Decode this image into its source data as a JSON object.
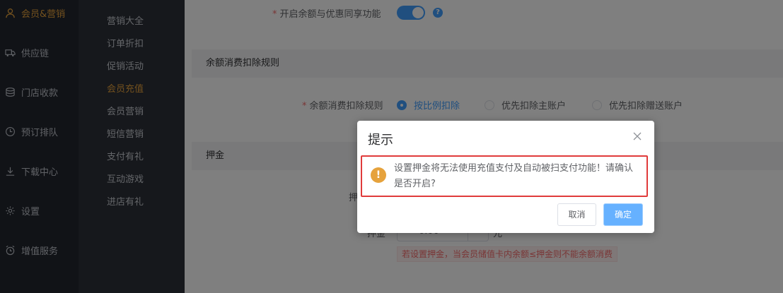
{
  "sidebar": {
    "items": [
      {
        "label": "会员&营销",
        "icon": "user-icon",
        "active": true
      },
      {
        "label": "供应链",
        "icon": "truck-icon",
        "active": false
      },
      {
        "label": "门店收款",
        "icon": "database-icon",
        "active": false
      },
      {
        "label": "预订排队",
        "icon": "clock-icon",
        "active": false
      },
      {
        "label": "下载中心",
        "icon": "download-icon",
        "active": false
      },
      {
        "label": "设置",
        "icon": "gear-icon",
        "active": false
      },
      {
        "label": "增值服务",
        "icon": "alarm-clock-icon",
        "active": false
      }
    ]
  },
  "subnav": {
    "items": [
      {
        "label": "营销大全",
        "active": false
      },
      {
        "label": "订单折扣",
        "active": false
      },
      {
        "label": "促销活动",
        "active": false
      },
      {
        "label": "会员充值",
        "active": true
      },
      {
        "label": "会员营销",
        "active": false
      },
      {
        "label": "短信营销",
        "active": false
      },
      {
        "label": "支付有礼",
        "active": false
      },
      {
        "label": "互动游戏",
        "active": false
      },
      {
        "label": "进店有礼",
        "active": false
      }
    ]
  },
  "form": {
    "share_label": "开启余额与优惠同享功能",
    "share_enabled": true,
    "help_glyph": "?",
    "section_deduction": "余额消费扣除规则",
    "deduction_label": "余额消费扣除规则",
    "deduction_options": [
      {
        "label": "按比例扣除",
        "checked": true
      },
      {
        "label": "优先扣除主账户",
        "checked": false
      },
      {
        "label": "优先扣除赠送账户",
        "checked": false
      }
    ],
    "section_deposit": "押金",
    "deposit_switch_label_partial": "押",
    "deposit_label": "押金",
    "deposit_value": "0.00",
    "deposit_unit": "元",
    "deposit_hint": "若设置押金，当会员储值卡内余额≤押金则不能余额消费"
  },
  "dialog": {
    "title": "提示",
    "message": "设置押金将无法使用充值支付及自动被扫支付功能！请确认是否开启?",
    "warn_glyph": "!",
    "cancel_label": "取消",
    "confirm_label": "确定"
  },
  "colors": {
    "accent": "#409eff",
    "active_nav": "#e6a23c",
    "highlight_border": "#e03b3b"
  }
}
